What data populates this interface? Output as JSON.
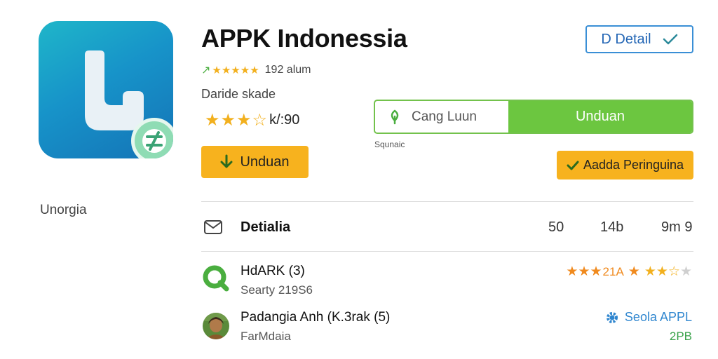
{
  "app": {
    "title": "APPK Indonessia",
    "side_label": "Unorgia",
    "icon": "app-logo-icon",
    "badge_icon": "no-ads-badge-icon",
    "accent": "#1793c9"
  },
  "header": {
    "detail_button": "D Detail",
    "detail_icon": "check-icon"
  },
  "rating": {
    "prefix": "↗",
    "stars": "★★★★★",
    "count": "192 alum",
    "stars_big": "★★★★",
    "score": "/  :90",
    "score_text": "½ /:90"
  },
  "developer": "Daride skade",
  "rating2_text": "k/:90",
  "segment": {
    "left_label": "Cang Luun",
    "right_label": "Unduan",
    "caption": "Squnaic",
    "left_color": "#73c24c"
  },
  "buttons": {
    "unduh": "Unduan",
    "peringkat": "Aadda Peringuina",
    "color": "#f7b21e"
  },
  "details": {
    "label": "Detialia",
    "stat1": "50",
    "stat2": "14b",
    "stat3": "9m 9"
  },
  "reviews": [
    {
      "name": "HdARK (3)",
      "sub": "Searty 219S6",
      "rating_num": "21A"
    },
    {
      "name": "Padangia Anh (K.3rak (5)",
      "sub": "FarMdaia",
      "action": "Seola APPL",
      "size": "2PB"
    }
  ]
}
